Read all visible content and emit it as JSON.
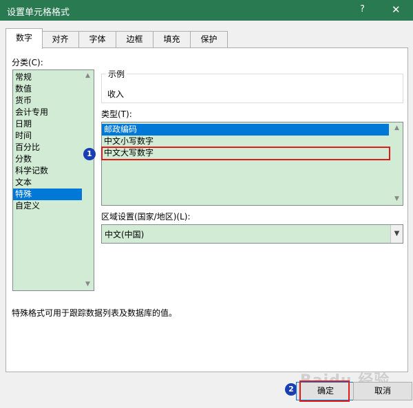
{
  "titlebar": {
    "title": "设置单元格格式",
    "help": "?",
    "close": "✕"
  },
  "tabs": [
    "数字",
    "对齐",
    "字体",
    "边框",
    "填充",
    "保护"
  ],
  "category": {
    "label": "分类(C):",
    "items": [
      "常规",
      "数值",
      "货币",
      "会计专用",
      "日期",
      "时间",
      "百分比",
      "分数",
      "科学记数",
      "文本",
      "特殊",
      "自定义"
    ],
    "selected": "特殊"
  },
  "sample": {
    "legend": "示例",
    "value": "收入"
  },
  "type": {
    "label": "类型(T):",
    "items": [
      "邮政编码",
      "中文小写数字",
      "中文大写数字"
    ],
    "selected": "邮政编码"
  },
  "locale": {
    "label": "区域设置(国家/地区)(L):",
    "value": "中文(中国)"
  },
  "description": "特殊格式可用于跟踪数据列表及数据库的值。",
  "buttons": {
    "ok": "确定",
    "cancel": "取消"
  },
  "annotations": {
    "badge1": "1",
    "badge2": "2"
  },
  "watermark": "Baidu 经验",
  "colors": {
    "titlebar": "#2a7a51",
    "list_bg": "#d1ebd5",
    "selection": "#0078d7",
    "highlight_box": "#e01919",
    "badge": "#1a3fb5"
  }
}
